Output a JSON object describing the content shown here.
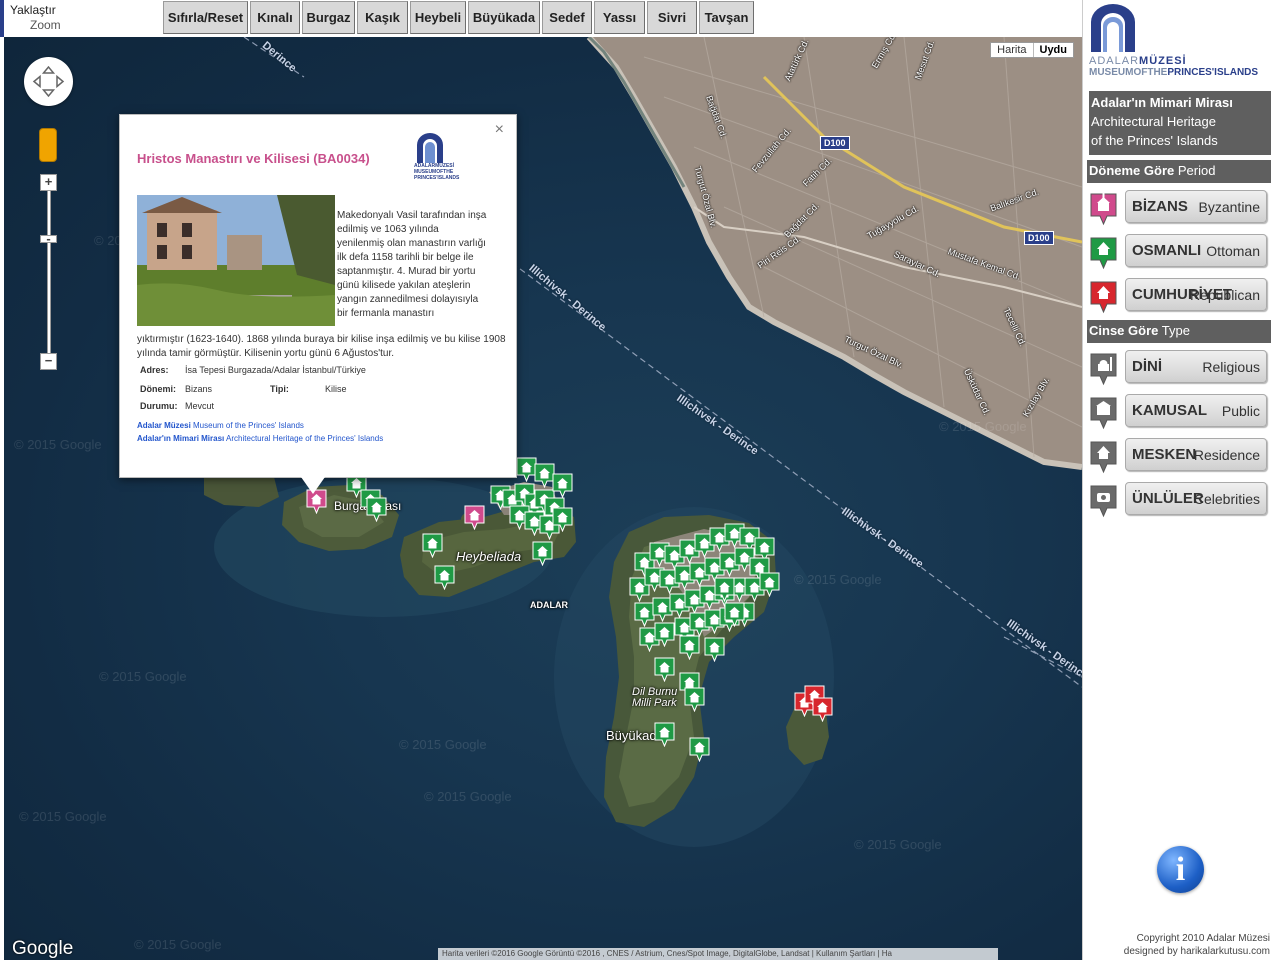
{
  "toolbar": {
    "zoom_tr": "Yaklaştır",
    "zoom_en": "Zoom",
    "buttons": [
      "Sıfırla/Reset",
      "Kınalı",
      "Burgaz",
      "Kaşık",
      "Heybeli",
      "Büyükada",
      "Sedef",
      "Yassı",
      "Sivri",
      "Tavşan"
    ]
  },
  "map": {
    "type_options": [
      "Harita",
      "Uydu"
    ],
    "selected_type": "Uydu",
    "labels": {
      "heybeliada": "Heybeliada",
      "burgazadasi": "Burgazadası",
      "adalar": "ADALAR",
      "dilburnu": "Dil Burnu\nMilli Park",
      "buyukada": "Büyükada"
    },
    "routes": [
      "Derince",
      "Illichivsk - Derince",
      "Illichivsk - Derince",
      "Illichivsk - Derince",
      "Illichivsk - Derince"
    ],
    "streets": [
      "Atatürk Cd.",
      "Fevzullah Cd.",
      "Fatih Cd.",
      "Turgut Özal Blv.",
      "Bağdat Cd.",
      "Piri Reis Cd.",
      "Tuğayyolu Cd.",
      "Saraylar Cd.",
      "Mustafa Kemal Cd.",
      "Balıkesir Cd.",
      "Tecelli Cd.",
      "Turgut Özal Blv.",
      "Üsküdar Cd.",
      "Kızılay Blv.",
      "Bağdat Cd.",
      "Ermış Cd.",
      "Mesut Cd."
    ],
    "road_shield": "D100",
    "google_logo": "Google",
    "attribution": "Harita verileri ©2016 Google Görüntü ©2016 , CNES / Astrium, Cnes/Spot Image, DigitalGlobe, Landsat  |  Kullanım Şartları  |  Ha",
    "watermark": "© 2015 Google"
  },
  "infowindow": {
    "title": "Hristos Manastırı ve Kilisesi (BA0034)",
    "logo_text_1": "ADALARMÜZESİ",
    "logo_text_2": "MUSEUMOFTHE",
    "logo_text_3": "PRINCES'ISLANDS",
    "desc_right": "Makedonyalı Vasil tarafından inşa edilmiş ve 1063 yılında yenilenmiş olan manastırın varlığı ilk defa 1158 tarihli bir belge ile saptanmıştır. 4. Murad bir yortu günü kilisede yakılan ateşlerin yangın zannedilmesi dolayısıyla bir fermanla manastırı",
    "desc_bottom": "yıktırmıştır (1623-1640). 1868 yılında buraya bir kilise inşa edilmiş ve bu kilise 1908 yılında tamir görmüştür. Kilisenin yortu günü 6 Ağustos'tur.",
    "address_label": "Adres:",
    "address": "İsa Tepesi Burgazada/Adalar İstanbul/Türkiye",
    "period_label": "Dönemi:",
    "period": "Bizans",
    "type_label": "Tipi:",
    "type": "Kilise",
    "status_label": "Durumu:",
    "status": "Mevcut",
    "link1_bold": "Adalar Müzesi",
    "link1": " Museum of the Princes' Islands",
    "link2_bold": "Adalar'ın Mimari Mirası",
    "link2": " Architectural Heritage of the Princes' Islands",
    "close": "×"
  },
  "panel": {
    "brand_1": "ADALAR",
    "brand_1b": "MÜZESİ",
    "brand_2a": "MUSEUM",
    "brand_2b": "OFTHE",
    "brand_2c": "PRINCES'ISLANDS",
    "title_tr": "Adalar'ın Mimari Mirası",
    "title_en1": "Architectural Heritage",
    "title_en2": "of the Princes' Islands",
    "period_head_tr": "Döneme Göre",
    "period_head_en": "Period",
    "period_filters": [
      {
        "tr": "BİZANS",
        "en": "Byzantine",
        "color": "#d04a8c"
      },
      {
        "tr": "OSMANLI",
        "en": "Ottoman",
        "color": "#1f9a45"
      },
      {
        "tr": "CUMHURİYET",
        "en": "Republican",
        "color": "#d7262d"
      }
    ],
    "type_head_tr": "Cinse Göre",
    "type_head_en": "Type",
    "type_filters": [
      {
        "tr": "DİNİ",
        "en": "Religious"
      },
      {
        "tr": "KAMUSAL",
        "en": "Public"
      },
      {
        "tr": "MESKEN",
        "en": "Residence"
      },
      {
        "tr": "ÜNLÜLER",
        "en": "Celebrities"
      }
    ],
    "info_icon": "i",
    "copyright_1": "Copyright 2010 Adalar Müzesi",
    "copyright_2": "designed by harikalarkutusu.com"
  },
  "colors": {
    "byzantine": "#d04a8c",
    "ottoman": "#1f9a45",
    "republican": "#d7262d",
    "panel_header": "#5f5f5f",
    "brand_blue": "#2a3f8a"
  }
}
